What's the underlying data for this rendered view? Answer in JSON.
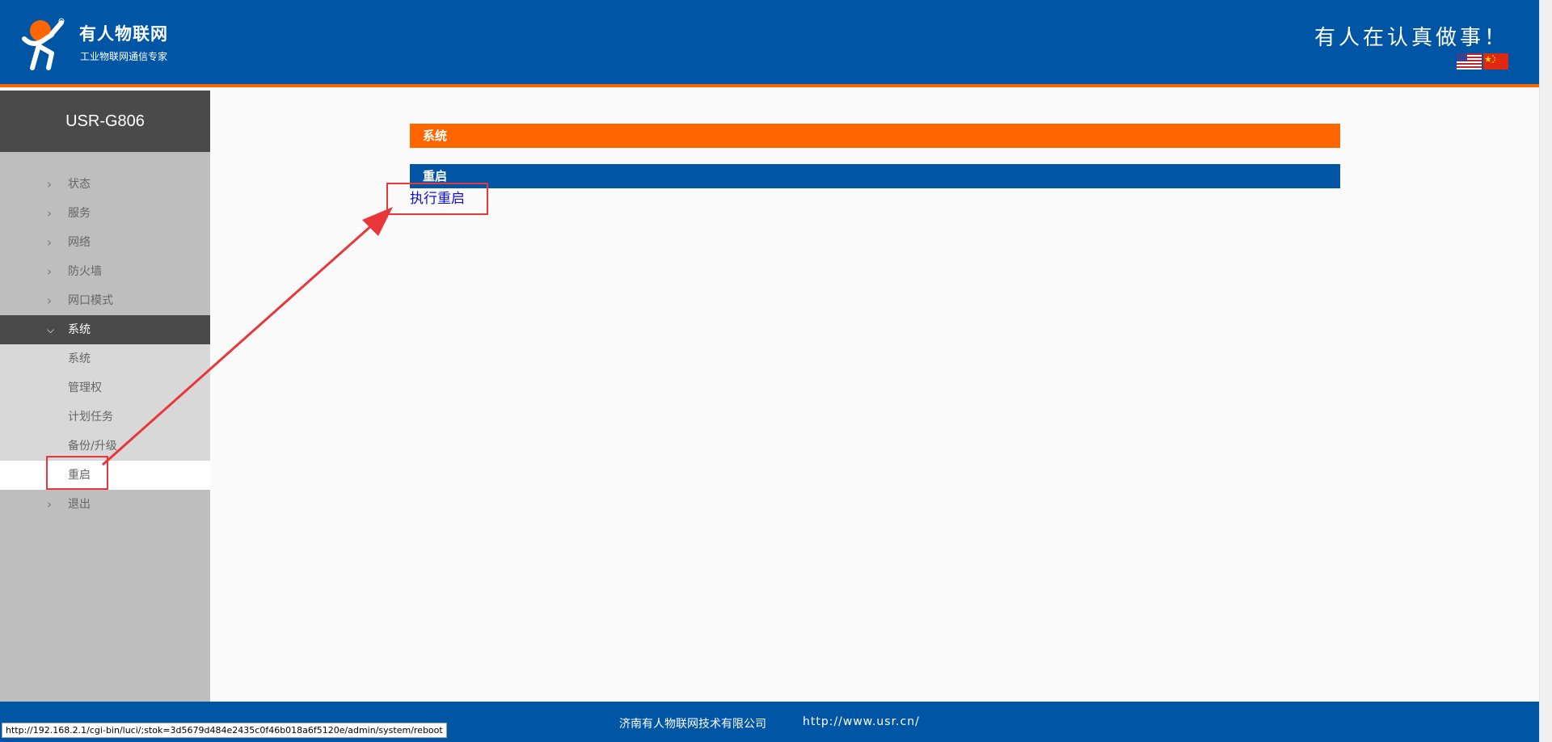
{
  "header": {
    "brand_name": "有人物联网",
    "brand_tagline": "工业物联网通信专家",
    "slogan": "有人在认真做事！",
    "colors": {
      "primary": "#0055a5",
      "accent": "#ff6600"
    }
  },
  "sidebar": {
    "device_title": "USR-G806",
    "menu": [
      {
        "label": "状态",
        "icon": "chevron-right-icon",
        "expanded": false
      },
      {
        "label": "服务",
        "icon": "chevron-right-icon",
        "expanded": false
      },
      {
        "label": "网络",
        "icon": "chevron-right-icon",
        "expanded": false
      },
      {
        "label": "防火墙",
        "icon": "chevron-right-icon",
        "expanded": false
      },
      {
        "label": "网口模式",
        "icon": "chevron-right-icon",
        "expanded": false
      },
      {
        "label": "系统",
        "icon": "chevron-down-icon",
        "expanded": true
      },
      {
        "label": "退出",
        "icon": "chevron-right-icon",
        "expanded": false
      }
    ],
    "system_submenu": [
      {
        "label": "系统"
      },
      {
        "label": "管理权"
      },
      {
        "label": "计划任务"
      },
      {
        "label": "备份/升级"
      },
      {
        "label": "重启",
        "current": true
      }
    ]
  },
  "main": {
    "section_title": "系统",
    "subsection_title": "重启",
    "action_link": "执行重启"
  },
  "footer": {
    "company": "济南有人物联网技术有限公司",
    "url": "http://www.usr.cn/"
  },
  "status_bar": {
    "hover_url": "http://192.168.2.1/cgi-bin/luci/;stok=3d5679d484e2435c0f46b018a6f5120e/admin/system/reboot"
  }
}
